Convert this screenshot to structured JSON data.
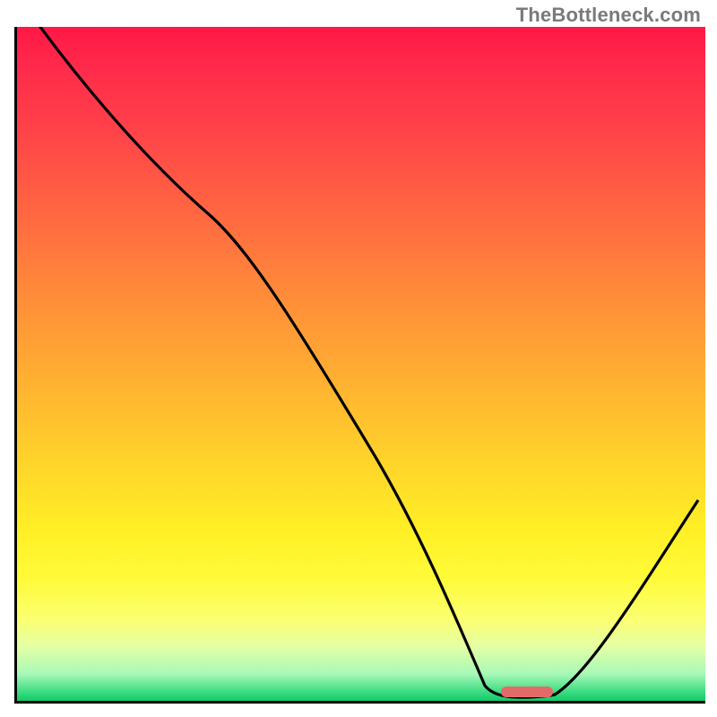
{
  "watermark": "TheBottleneck.com",
  "colors": {
    "curve": "#000000",
    "marker": "#e46a6a",
    "axis": "#000000"
  },
  "chart_data": {
    "type": "line",
    "title": "",
    "xlabel": "",
    "ylabel": "",
    "xlim": [
      0,
      100
    ],
    "ylim": [
      0,
      100
    ],
    "grid": false,
    "legend": false,
    "description": "Heatmap-style gradient background (red top → yellow middle → green bottom) with a black V-shaped bottleneck curve. The curve starts at the very top-left (≈(3,100)), descends steeply with a slight inflection around (28,72), continues down to a near-zero minimum spanning roughly x=68–78, then rises again to about (99,30). A small rounded red marker sits at the bottom of the valley near x≈73.",
    "series": [
      {
        "name": "bottleneck-curve",
        "points": [
          {
            "x": 3,
            "y": 100
          },
          {
            "x": 14,
            "y": 86
          },
          {
            "x": 28,
            "y": 72
          },
          {
            "x": 40,
            "y": 53
          },
          {
            "x": 52,
            "y": 33
          },
          {
            "x": 62,
            "y": 13
          },
          {
            "x": 68,
            "y": 2
          },
          {
            "x": 72,
            "y": 0.5
          },
          {
            "x": 78,
            "y": 0.8
          },
          {
            "x": 85,
            "y": 8
          },
          {
            "x": 92,
            "y": 18
          },
          {
            "x": 99,
            "y": 30
          }
        ]
      }
    ],
    "marker": {
      "x_start": 70,
      "x_end": 77,
      "y": 1
    }
  }
}
